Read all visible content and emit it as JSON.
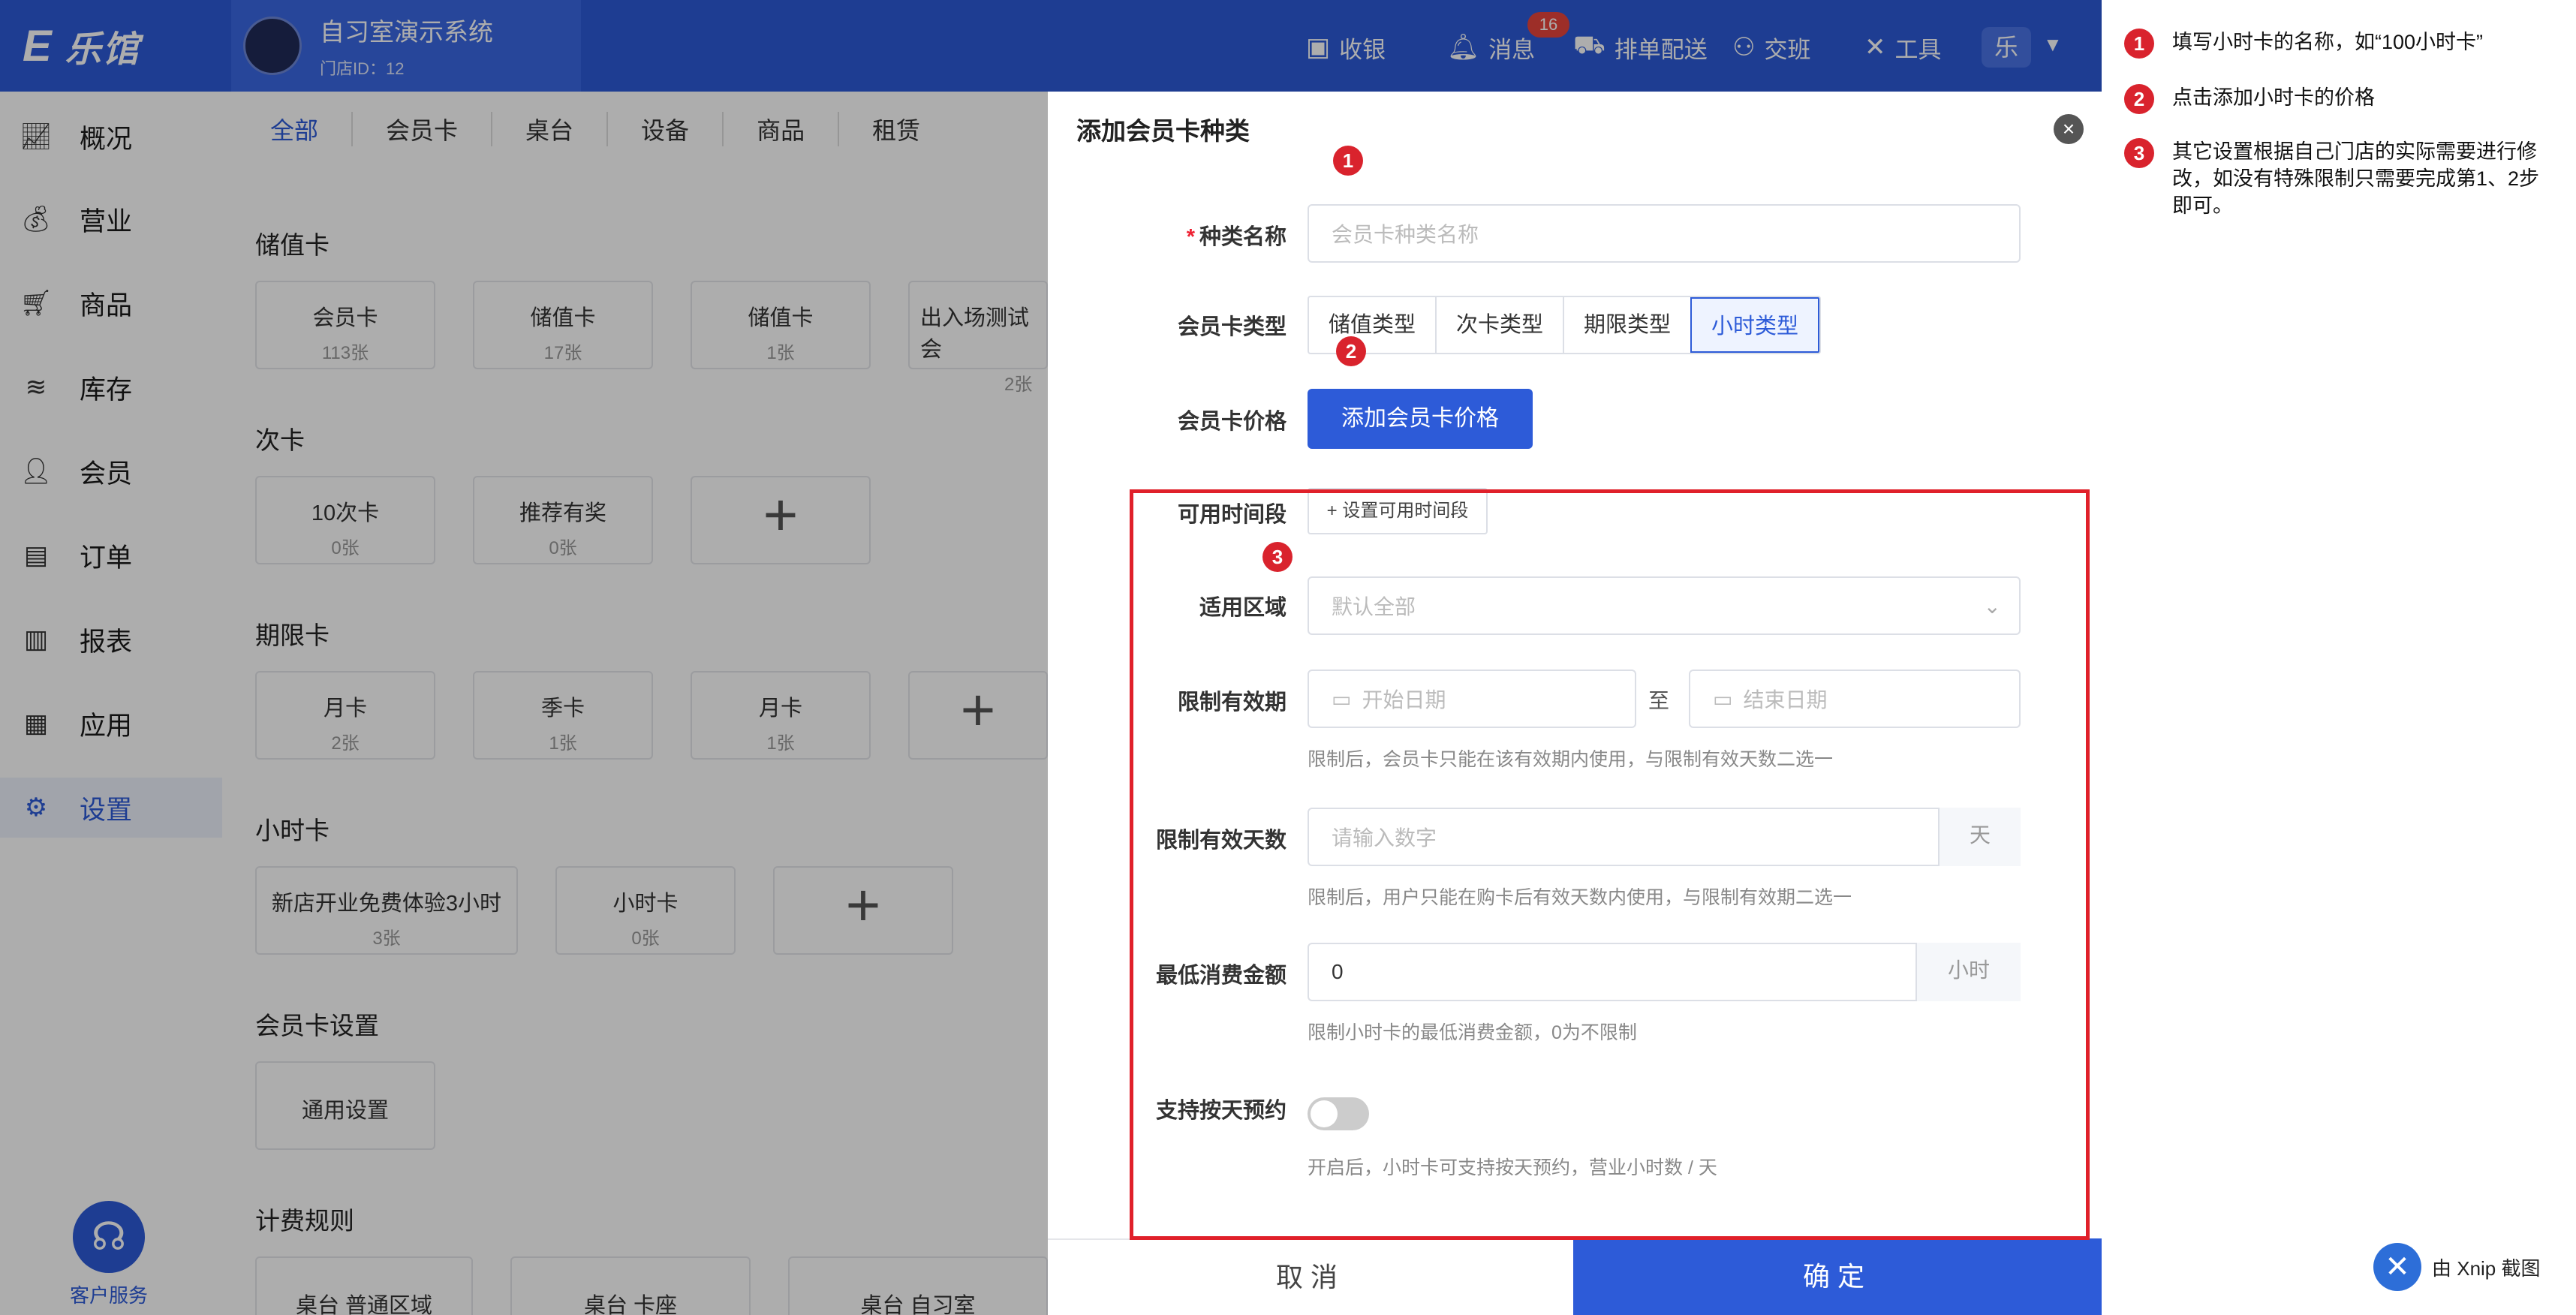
{
  "app": {
    "logo_mark": "E",
    "logo_name": "乐馆",
    "store_title": "自习室演示系统",
    "store_id": "门店ID：12"
  },
  "topnav": {
    "cashier": "收银",
    "messages": "消息",
    "message_count": "16",
    "schedule": "排单配送",
    "handover": "交班",
    "tools": "工具",
    "user_initial": "乐"
  },
  "sidebar": {
    "items": [
      {
        "label": "概况",
        "icon": "chart-line-icon"
      },
      {
        "label": "营业",
        "icon": "money-bag-icon"
      },
      {
        "label": "商品",
        "icon": "cart-icon"
      },
      {
        "label": "库存",
        "icon": "layers-icon"
      },
      {
        "label": "会员",
        "icon": "users-icon"
      },
      {
        "label": "订单",
        "icon": "order-icon"
      },
      {
        "label": "报表",
        "icon": "bar-chart-icon"
      },
      {
        "label": "应用",
        "icon": "apps-icon"
      },
      {
        "label": "设置",
        "icon": "gear-icon",
        "active": true
      }
    ],
    "service": "客户服务"
  },
  "tabs": [
    "全部",
    "会员卡",
    "桌台",
    "设备",
    "商品",
    "租赁"
  ],
  "content": {
    "stored_value": {
      "title": "储值卡",
      "cards": [
        {
          "name": "会员卡",
          "count": "113张"
        },
        {
          "name": "储值卡",
          "count": "17张"
        },
        {
          "name": "储值卡",
          "count": "1张"
        },
        {
          "name": "出入场测试会",
          "count": "2张"
        }
      ]
    },
    "times": {
      "title": "次卡",
      "cards": [
        {
          "name": "10次卡",
          "count": "0张"
        },
        {
          "name": "推荐有奖",
          "count": "0张"
        }
      ]
    },
    "period": {
      "title": "期限卡",
      "cards": [
        {
          "name": "月卡",
          "count": "2张"
        },
        {
          "name": "季卡",
          "count": "1张"
        },
        {
          "name": "月卡",
          "count": "1张"
        }
      ]
    },
    "hourly": {
      "title": "小时卡",
      "cards": [
        {
          "name": "新店开业免费体验3小时",
          "count": "3张"
        },
        {
          "name": "小时卡",
          "count": "0张"
        }
      ]
    },
    "settings": {
      "title": "会员卡设置",
      "general": "通用设置"
    },
    "billing": {
      "title": "计费规则",
      "cards": [
        "桌台 普通区域",
        "桌台 卡座",
        "桌台 自习室"
      ]
    }
  },
  "drawer": {
    "title": "添加会员卡种类",
    "name_label": "种类名称",
    "name_placeholder": "会员卡种类名称",
    "type_label": "会员卡类型",
    "types": [
      "储值类型",
      "次卡类型",
      "期限类型",
      "小时类型"
    ],
    "selected_type": "小时类型",
    "price_label": "会员卡价格",
    "price_button": "添加会员卡价格",
    "timeseg_label": "可用时间段",
    "timeseg_button": "+ 设置可用时间段",
    "area_label": "适用区域",
    "area_placeholder": "默认全部",
    "validity_label": "限制有效期",
    "start_placeholder": "开始日期",
    "to": "至",
    "end_placeholder": "结束日期",
    "validity_hint": "限制后，会员卡只能在该有效期内使用，与限制有效天数二选一",
    "days_label": "限制有效天数",
    "days_placeholder": "请输入数字",
    "days_suffix": "天",
    "days_hint": "限制后，用户只能在购卡后有效天数内使用，与限制有效期二选一",
    "min_label": "最低消费金额",
    "min_value": "0",
    "min_suffix": "小时",
    "min_hint": "限制小时卡的最低消费金额，0为不限制",
    "daily_label": "支持按天预约",
    "daily_hint": "开启后，小时卡可支持按天预约，营业小时数 / 天",
    "cancel": "取消",
    "confirm": "确定"
  },
  "annotations": {
    "badges": [
      "1",
      "2",
      "3"
    ],
    "notes": [
      "填写小时卡的名称，如“100小时卡”",
      "点击添加小时卡的价格",
      "其它设置根据自己门店的实际需要进行修改，如没有特殊限制只需要完成第1、2步即可。"
    ],
    "highlight_color": "#e0202a"
  },
  "watermark": {
    "credit": "由 Xnip 截图"
  },
  "colors": {
    "primary": "#2d5bd8",
    "annotation_red": "#d9232d"
  }
}
